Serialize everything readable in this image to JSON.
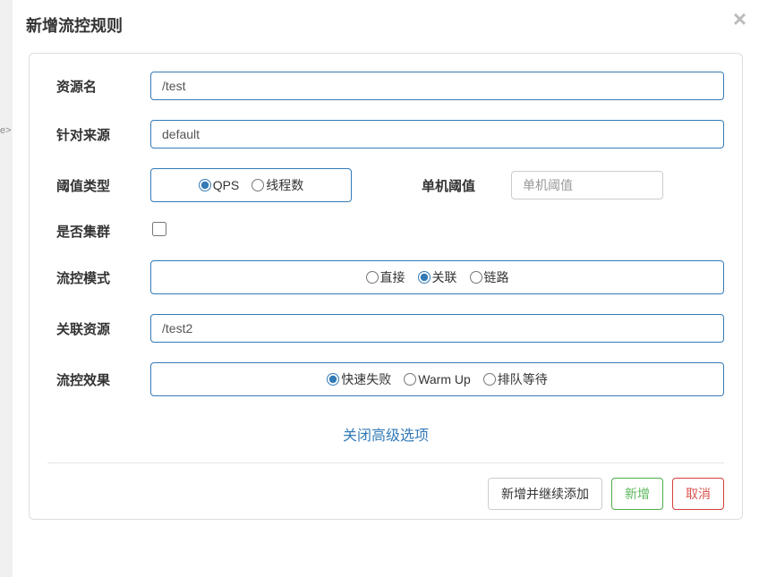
{
  "modal": {
    "title": "新增流控规则",
    "close": "×"
  },
  "labels": {
    "resource": "资源名",
    "source": "针对来源",
    "threshold_type": "阈值类型",
    "single_threshold": "单机阈值",
    "cluster": "是否集群",
    "flow_mode": "流控模式",
    "related_resource": "关联资源",
    "flow_effect": "流控效果"
  },
  "values": {
    "resource": "/test",
    "source": "default",
    "related_resource": "/test2",
    "threshold_placeholder": "单机阈值"
  },
  "threshold_type_options": {
    "qps": "QPS",
    "threads": "线程数"
  },
  "flow_mode_options": {
    "direct": "直接",
    "relate": "关联",
    "chain": "链路"
  },
  "flow_effect_options": {
    "fast_fail": "快速失败",
    "warm_up": "Warm Up",
    "queue": "排队等待"
  },
  "advanced_link": "关闭高级选项",
  "buttons": {
    "add_continue": "新增并继续添加",
    "add": "新增",
    "cancel": "取消"
  },
  "strip": "e>"
}
